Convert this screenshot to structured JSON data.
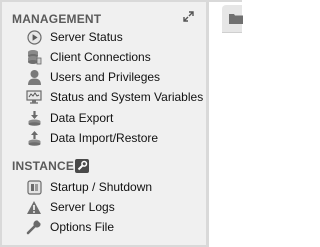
{
  "management": {
    "header": "MANAGEMENT",
    "items": [
      {
        "label": "Server Status",
        "icon": "play-circle-icon"
      },
      {
        "label": "Client Connections",
        "icon": "database-connections-icon"
      },
      {
        "label": "Users and Privileges",
        "icon": "user-icon"
      },
      {
        "label": "Status and System Variables",
        "icon": "monitor-icon"
      },
      {
        "label": "Data Export",
        "icon": "export-icon"
      },
      {
        "label": "Data Import/Restore",
        "icon": "import-icon"
      }
    ]
  },
  "instance": {
    "header": "INSTANCE",
    "items": [
      {
        "label": "Startup / Shutdown",
        "icon": "power-icon"
      },
      {
        "label": "Server Logs",
        "icon": "warning-icon"
      },
      {
        "label": "Options File",
        "icon": "wrench-icon"
      }
    ]
  },
  "colors": {
    "sidebar_bg": "#f0f0f0",
    "header_text": "#5a5a5a",
    "item_text": "#111111",
    "folder": "#707070"
  }
}
